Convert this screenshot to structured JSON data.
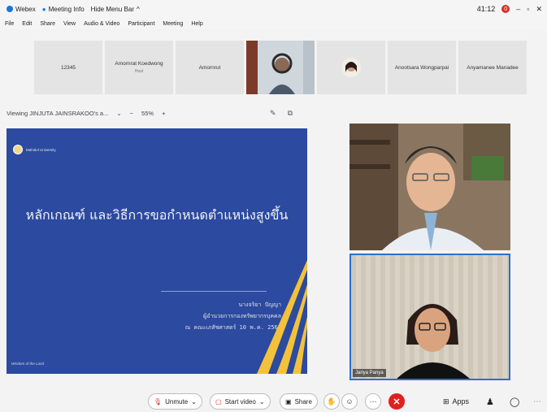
{
  "titlebar": {
    "app": "Webex",
    "meeting_info": "Meeting Info",
    "hide_menu": "Hide Menu Bar",
    "hide_menu_chevron": "^",
    "time": "41:12",
    "notif_count": "0",
    "minimize": "–",
    "restore": "▫",
    "close": "✕"
  },
  "menu": [
    "File",
    "Edit",
    "Share",
    "View",
    "Audio & Video",
    "Participant",
    "Meeting",
    "Help"
  ],
  "participants": [
    {
      "name": "12345",
      "sub": ""
    },
    {
      "name": "Amornrat Koedwong",
      "sub": "Host"
    },
    {
      "name": "Amornrut",
      "sub": ""
    },
    {
      "name": "",
      "sub": ""
    },
    {
      "name": "",
      "sub": ""
    },
    {
      "name": "Anootsara Wongparpai",
      "sub": ""
    },
    {
      "name": "Anyamanee Manadee",
      "sub": ""
    }
  ],
  "share": {
    "viewing": "Viewing JINJUTA JAINSRAKOO's a...",
    "chevron": "⌄",
    "zoom_minus": "−",
    "zoom": "55%",
    "zoom_plus": "+"
  },
  "slide": {
    "org": "Mahidol University",
    "title": "หลักเกณฑ์ และวิธีการขอกำหนดตำแหน่งสูงขึ้น",
    "presenter_line1": "นางจริยา ปัญญา",
    "presenter_line2": "ผู้อำนวยการกองทรัพยากรบุคคล",
    "presenter_line3": "ณ คณะเภสัชศาสตร์ 10 พ.ค. 2565",
    "signature": "Wisdom of the Land"
  },
  "videos": [
    {
      "name": ""
    },
    {
      "name": "Jariya Panya"
    }
  ],
  "controls": {
    "unmute": "Unmute",
    "start_video": "Start video",
    "share": "Share",
    "more": "···",
    "end": "✕",
    "apps": "Apps",
    "dropdown": "⌄"
  },
  "colors": {
    "accent": "#2d6fd1",
    "slide_bg": "#2b4aa0",
    "end_red": "#e02020",
    "mute_red": "#d93025"
  }
}
